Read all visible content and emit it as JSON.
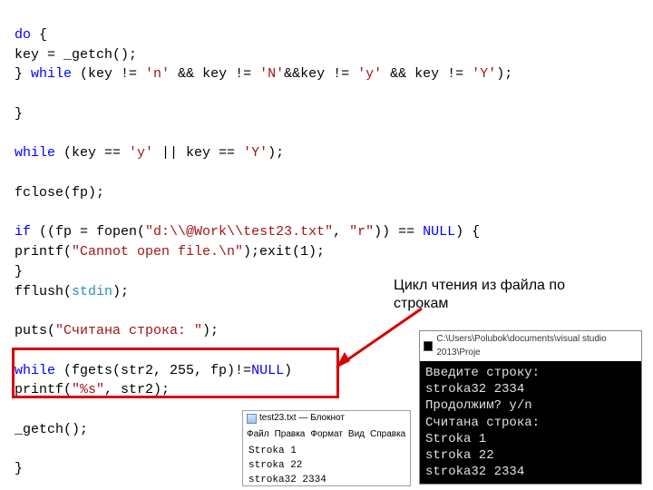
{
  "code": {
    "l1a": "do",
    "l1b": " {",
    "l2": "key = _getch();",
    "l3a": "} ",
    "l3b": "while",
    "l3c": " (key != ",
    "l3d": "'n'",
    "l3e": " && key != ",
    "l3f": "'N'",
    "l3g": "&&key != ",
    "l3h": "'y'",
    "l3i": " && key != ",
    "l3j": "'Y'",
    "l3k": ");",
    "l4": "}",
    "l5a": "while",
    "l5b": " (key == ",
    "l5c": "'y'",
    "l5d": " || key == ",
    "l5e": "'Y'",
    "l5f": ");",
    "l6": "fclose(fp);",
    "l7a": "if",
    "l7b": " ((fp = fopen(",
    "l7c": "\"d:\\\\@Work\\\\test23.txt\"",
    "l7d": ", ",
    "l7e": "\"r\"",
    "l7f": ")) == ",
    "l7g": "NULL",
    "l7h": ") {",
    "l8a": "printf(",
    "l8b": "\"Cannot open file.\\n\"",
    "l8c": ");exit(1);",
    "l9": "}",
    "l10a": "fflush(",
    "l10b": "stdin",
    "l10c": ");",
    "l11a": "puts(",
    "l11b": "\"Считана строка: \"",
    "l11c": ");",
    "l12a": "while",
    "l12b": " (fgets(str2, 255, fp)!=",
    "l12c": "NULL",
    "l12d": ")",
    "l13a": "printf(",
    "l13b": "\"%s\"",
    "l13c": ", str2);",
    "l14": "_getch();",
    "l15": "}"
  },
  "annotation": {
    "line1": "Цикл чтения из файла по",
    "line2": "строкам"
  },
  "notepad": {
    "title": "test23.txt — Блокнот",
    "menu": [
      "Файл",
      "Правка",
      "Формат",
      "Вид",
      "Справка"
    ],
    "lines": [
      "Stroka 1",
      "stroka 22",
      "stroka32 2334"
    ]
  },
  "console": {
    "title": "C:\\Users\\Polubok\\documents\\visual studio 2013\\Proje",
    "lines": [
      "Введите строку:",
      "stroka32 2334",
      "Продолжим? y/n",
      "Считана строка:",
      "Stroka 1",
      "stroka 22",
      "stroka32 2334"
    ]
  }
}
